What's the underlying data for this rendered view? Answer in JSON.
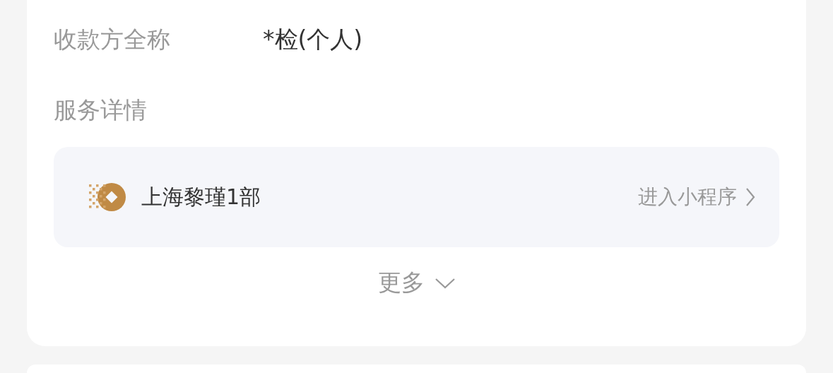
{
  "fields": [
    {
      "label": "收款方全称",
      "value": "*检(个人)"
    }
  ],
  "section_title": "服务详情",
  "merchant": {
    "name": "上海黎瑾1部",
    "action": "进入小程序"
  },
  "more": {
    "label": "更多",
    "expanded": false
  }
}
